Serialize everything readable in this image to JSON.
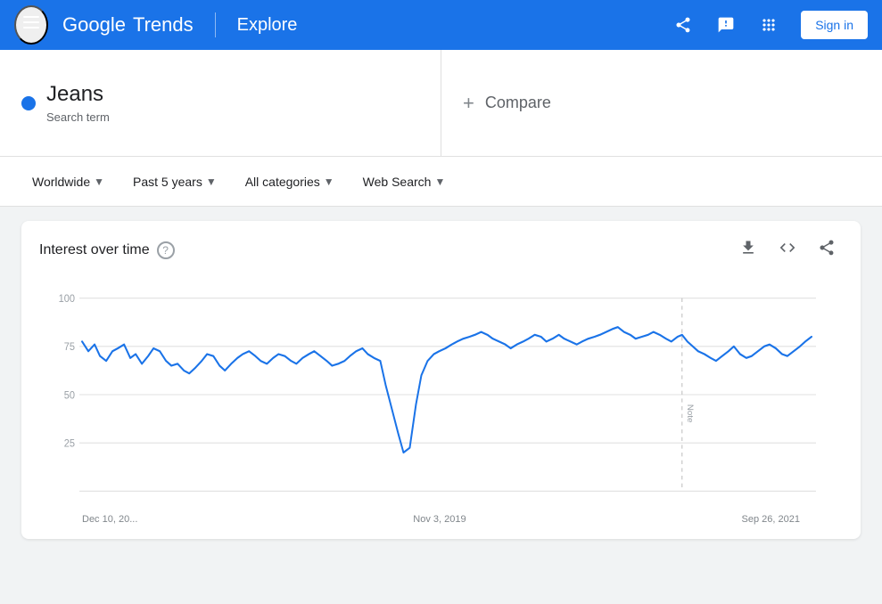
{
  "header": {
    "menu_icon": "☰",
    "logo_google": "Google",
    "logo_trends": "Trends",
    "divider": "|",
    "explore": "Explore",
    "share_icon": "share",
    "feedback_icon": "!",
    "apps_icon": "⋮⋮⋮",
    "signin_label": "Sign in"
  },
  "search": {
    "term_name": "Jeans",
    "term_type": "Search term",
    "compare_label": "Compare",
    "compare_plus": "+"
  },
  "filters": {
    "location": "Worldwide",
    "time_range": "Past 5 years",
    "category": "All categories",
    "search_type": "Web Search"
  },
  "chart": {
    "title": "Interest over time",
    "help": "?",
    "y_labels": [
      "100",
      "75",
      "50",
      "25"
    ],
    "x_labels": [
      "Dec 10, 20...",
      "Nov 3, 2019",
      "Sep 26, 2021"
    ],
    "note_label": "Note"
  }
}
